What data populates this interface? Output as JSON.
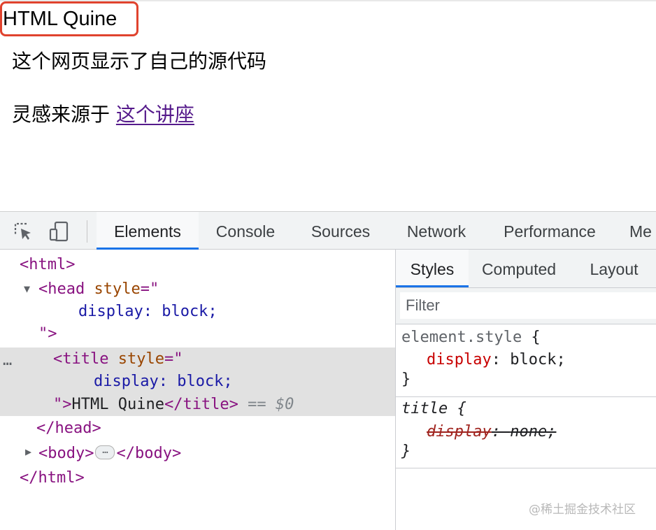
{
  "page": {
    "title": "HTML Quine",
    "paragraph1": "这个网页显示了自己的源代码",
    "paragraph2_prefix": "灵感来源于 ",
    "link_text": "这个讲座"
  },
  "devtools": {
    "tabs": [
      "Elements",
      "Console",
      "Sources",
      "Network",
      "Performance",
      "Me"
    ],
    "active_tab": "Elements",
    "elements": {
      "html_open": "<html>",
      "head_open": "<head ",
      "style_attr": "style",
      "style_eq": "=\"",
      "style_value": "display: block;",
      "close_quote": "\"",
      "close_bracket": ">",
      "title_open": "<title ",
      "title_text": "HTML Quine",
      "title_close": "</title>",
      "selected_marker": " == ",
      "selected_var": "$0",
      "head_close": "</head>",
      "body_open": "<body>",
      "body_close": "</body>",
      "html_close": "</html>",
      "dots": "…"
    },
    "styles_tabs": [
      "Styles",
      "Computed",
      "Layout"
    ],
    "active_styles_tab": "Styles",
    "filter_placeholder": "Filter",
    "rules": [
      {
        "selector": "element.style",
        "open": " {",
        "property": "display",
        "colon": ": ",
        "value": "block;",
        "close": "}",
        "overridden": false
      },
      {
        "selector": "title",
        "open": " {",
        "property": "display",
        "colon": ": ",
        "value": "none;",
        "close": "}",
        "overridden": true
      }
    ]
  },
  "watermark": "@稀土掘金技术社区",
  "colors": {
    "highlight_border": "#e0432e",
    "active_tab_underline": "#1a73e8",
    "tag": "#881280",
    "attribute": "#994500",
    "attribute_value": "#1a1aa6",
    "css_property": "#c80000",
    "link": "#551a8b"
  }
}
